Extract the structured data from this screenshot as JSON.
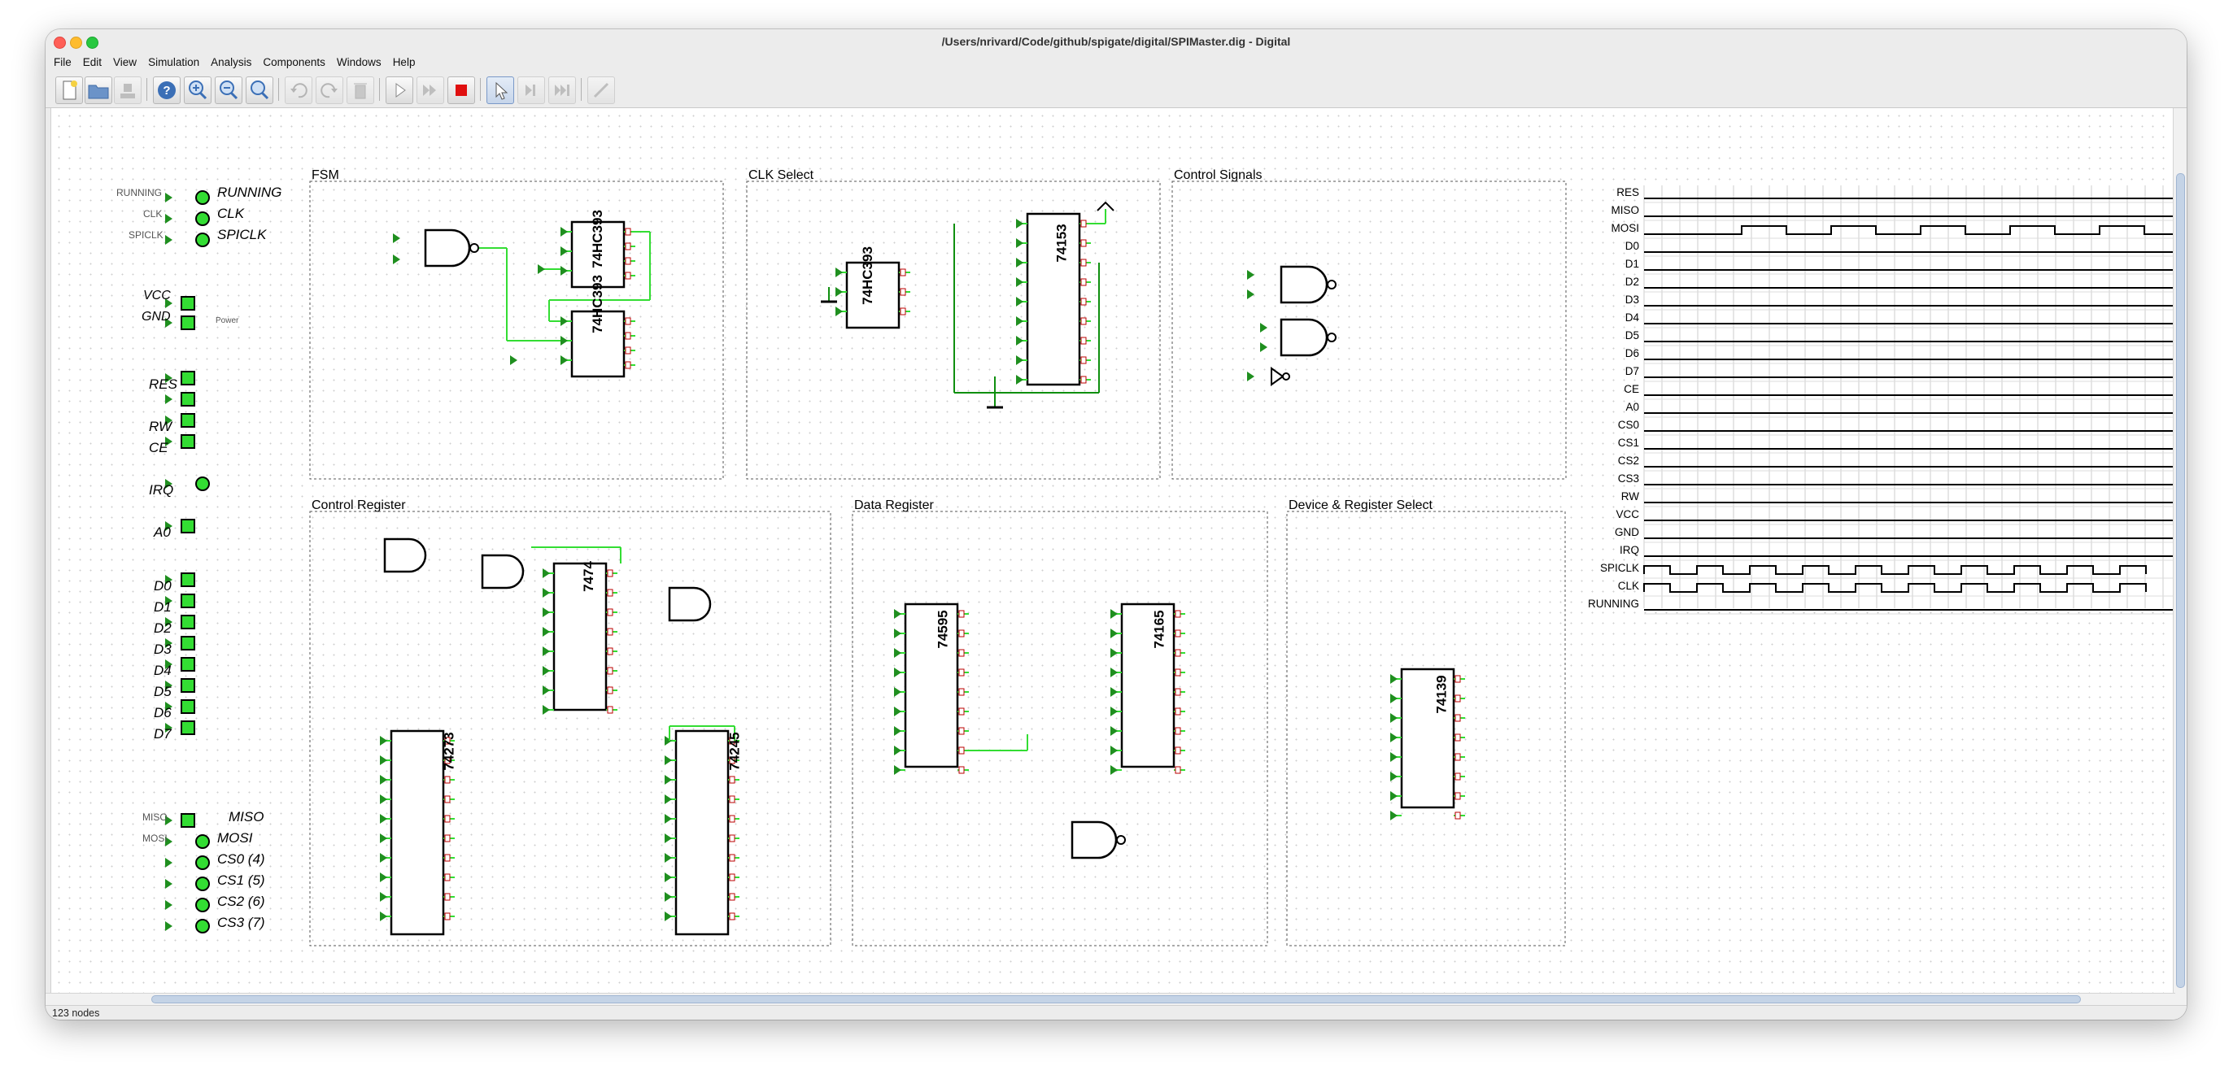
{
  "window": {
    "title": "/Users/nrivard/Code/github/spigate/digital/SPIMaster.dig - Digital"
  },
  "menu": [
    "File",
    "Edit",
    "View",
    "Simulation",
    "Analysis",
    "Components",
    "Windows",
    "Help"
  ],
  "toolbar": {
    "icons": [
      "new-file-icon",
      "open-folder-icon",
      "save-icon",
      "help-icon",
      "zoom-in-icon",
      "zoom-out-icon",
      "zoom-fit-icon",
      "undo-icon",
      "redo-icon",
      "delete-icon",
      "start-icon",
      "fast-forward-icon",
      "stop-icon",
      "pointer-icon",
      "step-icon",
      "step-forward-icon",
      "wire-icon"
    ],
    "stop_color": "#e01010"
  },
  "status": {
    "text": "123 nodes"
  },
  "palette": {
    "wire_active": "#33dd33",
    "wire_dark": "#0f8f0f",
    "pin": "#1f8f1f"
  },
  "groups": {
    "fsm": "FSM",
    "clk": "CLK Select",
    "ctl": "Control Signals",
    "creg": "Control Register",
    "dreg": "Data Register",
    "dsel": "Device & Register Select"
  },
  "chips": {
    "c1": "74HC393",
    "c2": "74HC393",
    "c3": "74HC393",
    "c4": "74153",
    "c5": "7474",
    "c6": "74273",
    "c7": "74245",
    "c8": "74595",
    "c9": "74165",
    "c10": "74139"
  },
  "io": {
    "running": "RUNNING",
    "clk": "CLK",
    "spiclk": "SPICLK",
    "vcc": "VCC",
    "gnd": "GND",
    "power": "Power",
    "miso": "MISO",
    "mosi": "MOSI",
    "cs": [
      "CS0 (4)",
      "CS1 (5)",
      "CS2 (6)",
      "CS3 (7)"
    ],
    "pins": [
      "RES",
      "CLK",
      "RW",
      "CE",
      "IRQ",
      "A0",
      "D0",
      "D1",
      "D2",
      "D3",
      "D4",
      "D5",
      "D6",
      "D7"
    ]
  },
  "timing": {
    "signals": [
      "RES",
      "MISO",
      "MOSI",
      "D0",
      "D1",
      "D2",
      "D3",
      "D4",
      "D5",
      "D6",
      "D7",
      "CE",
      "A0",
      "CS0",
      "CS1",
      "CS2",
      "CS3",
      "RW",
      "VCC",
      "GND",
      "IRQ",
      "SPICLK",
      "CLK",
      "RUNNING"
    ]
  }
}
